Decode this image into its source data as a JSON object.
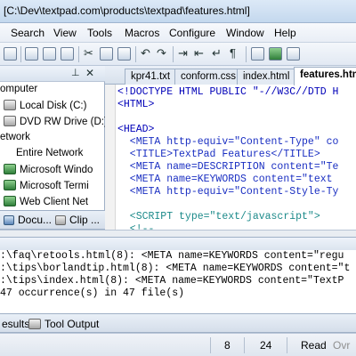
{
  "window": {
    "title": "[C:\\Dev\\textpad.com\\products\\textpad\\features.html]"
  },
  "menu": {
    "items": [
      "Search",
      "View",
      "Tools",
      "Macros",
      "Configure",
      "Window",
      "Help"
    ]
  },
  "toolbar": {
    "icons": [
      "open-icon",
      "print-icon",
      "print-preview-icon",
      "spell-check-icon",
      "cut-icon",
      "copy-icon",
      "paste-icon",
      "undo-icon",
      "redo-icon",
      "indent-icon",
      "outdent-icon",
      "word-wrap-icon",
      "pilcrow-icon",
      "tools-icon",
      "browser-icon",
      "options-icon"
    ]
  },
  "left_panel": {
    "tree": [
      {
        "label": "omputer",
        "icon": "computer-icon"
      },
      {
        "label": "Local Disk (C:)",
        "icon": "drive-icon"
      },
      {
        "label": "DVD RW Drive (D:)",
        "icon": "dvd-drive-icon"
      },
      {
        "label": "etwork",
        "icon": "network-icon"
      },
      {
        "label": "Entire Network",
        "icon": "network-icon"
      },
      {
        "label": "Microsoft Windo",
        "icon": "network-icon"
      },
      {
        "label": "Microsoft Termi",
        "icon": "network-icon"
      },
      {
        "label": "Web Client Net",
        "icon": "network-icon"
      }
    ],
    "tabs": [
      "Docu...",
      "Clip ..."
    ]
  },
  "editor": {
    "tabs": [
      "kpr41.txt",
      "conform.css",
      "index.html",
      "features.htm"
    ],
    "active_tab": "features.htm",
    "lines": [
      "<!DOCTYPE HTML PUBLIC \"-//W3C//DTD H",
      "<HTML>",
      "",
      "<HEAD>",
      "  <META http-equiv=\"Content-Type\" co",
      "  <TITLE>TextPad Features</TITLE>",
      "  <META name=DESCRIPTION content=\"Te",
      "  <META name=KEYWORDS content=\"text",
      "  <META http-equiv=\"Content-Style-Ty",
      "",
      "  <SCRIPT type=\"text/javascript\">",
      "  <!--"
    ]
  },
  "output": {
    "lines": [
      ":\\faq\\retools.html(8): <META name=KEYWORDS content=\"regu",
      ":\\tips\\borlandtip.html(8): <META name=KEYWORDS content=\"t",
      ":\\tips\\index.html(8): <META name=KEYWORDS content=\"TextP",
      "47 occurrence(s) in 47 file(s)"
    ]
  },
  "bottom_tabs": [
    "esults",
    "Tool Output"
  ],
  "status": {
    "line": "8",
    "column": "24",
    "mode": "Read",
    "overwrite": "Ovr"
  },
  "colors": {
    "keyword": "#1a2fc2",
    "string": "#1c8a8a",
    "tag": "#0000b8",
    "titlebar": "#c4d8ee"
  }
}
